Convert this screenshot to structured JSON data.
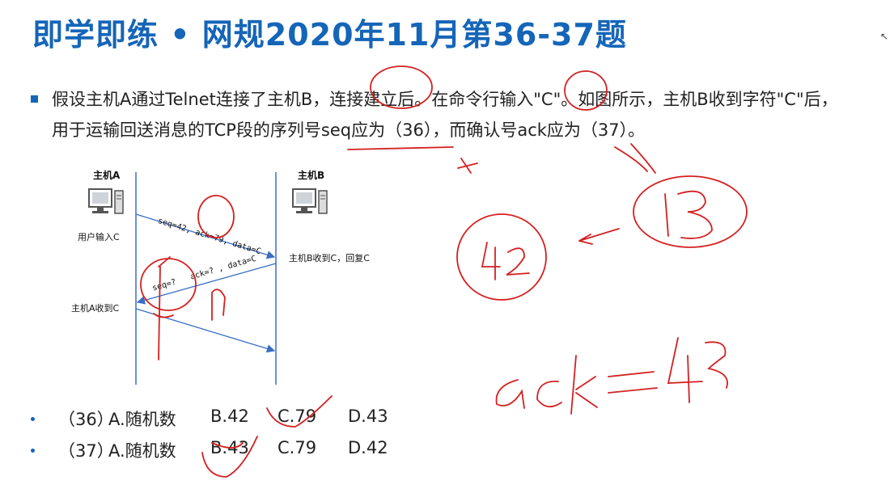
{
  "slide": {
    "title": "即学即练 • 网规2020年11月第36-37题",
    "question": "假设主机A通过Telnet连接了主机B，连接建立后。在命令行输入\"C\"。如图所示，主机B收到字符\"C\"后，用于运输回送消息的TCP段的序列号seq应为（36），而确认号ack应为（37）。"
  },
  "diagram": {
    "host_a": "主机A",
    "host_b": "主机B",
    "a_event1": "用户输入C",
    "b_event": "主机B收到C，回复C",
    "a_event2": "主机A收到C",
    "msg1": "seq=42, ack=79, data=C",
    "msg2_seq": "seq=?",
    "msg2_rest": "ack=? , data=C"
  },
  "options": [
    {
      "num": "（36）",
      "a": "A.随机数",
      "b": "B.42",
      "c": "C.79",
      "d": "D.43"
    },
    {
      "num": "（37）",
      "a": "A.随机数",
      "b": "B.43",
      "c": "C.79",
      "d": "D.42"
    }
  ],
  "colors": {
    "title": "#1565b8",
    "arrow": "#3a6fc4",
    "ink": "#d42020"
  }
}
